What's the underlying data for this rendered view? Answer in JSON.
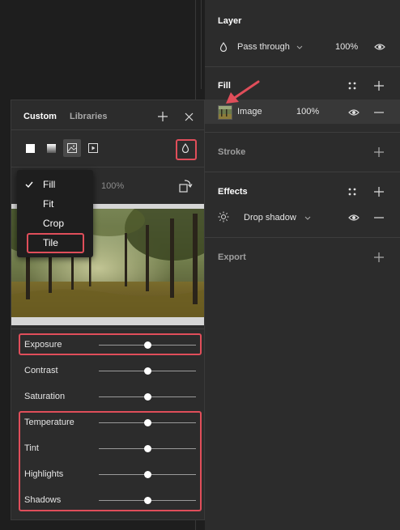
{
  "layer": {
    "title": "Layer",
    "blend_mode": "Pass through",
    "opacity": "100%"
  },
  "fill": {
    "title": "Fill",
    "type_label": "Image",
    "opacity": "100%"
  },
  "stroke": {
    "title": "Stroke"
  },
  "effects": {
    "title": "Effects",
    "effect_label": "Drop shadow"
  },
  "export": {
    "title": "Export"
  },
  "picker": {
    "tabs": [
      "Custom",
      "Libraries"
    ],
    "fill_types": [
      "solid",
      "gradient",
      "image",
      "video"
    ],
    "image_opacity": "100%",
    "scale_menu": {
      "options": [
        "Fill",
        "Fit",
        "Crop",
        "Tile"
      ],
      "selected": "Fill",
      "highlighted": "Tile"
    },
    "adjustments": [
      {
        "label": "Exposure",
        "value": 0.5
      },
      {
        "label": "Contrast",
        "value": 0.5
      },
      {
        "label": "Saturation",
        "value": 0.5
      },
      {
        "label": "Temperature",
        "value": 0.5
      },
      {
        "label": "Tint",
        "value": 0.5
      },
      {
        "label": "Highlights",
        "value": 0.5
      },
      {
        "label": "Shadows",
        "value": 0.5
      }
    ]
  },
  "colors": {
    "panel": "#2c2c2c",
    "canvas": "#1e1e1e",
    "annotation": "#e04e5a"
  }
}
